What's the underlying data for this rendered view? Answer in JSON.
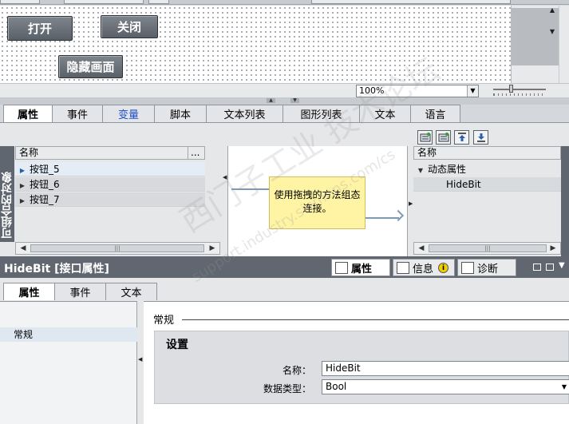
{
  "canvas": {
    "buttons": {
      "open": "打开",
      "close": "关闭",
      "hide_screen": "隐藏画面"
    },
    "zoom": "100%"
  },
  "top_tabs": [
    {
      "label": "属性"
    },
    {
      "label": "事件"
    },
    {
      "label": "变量"
    },
    {
      "label": "脚本"
    },
    {
      "label": "文本列表"
    },
    {
      "label": "图形列表"
    },
    {
      "label": "文本"
    },
    {
      "label": "语言"
    }
  ],
  "left_panel": {
    "side_label": "可组合的对象",
    "header": "名称",
    "header_more": "...",
    "rows": [
      "按钮_5",
      "按钮_6",
      "按钮_7"
    ]
  },
  "center_panel": {
    "hint": "使用拖拽的方法组态连接。"
  },
  "right_panel": {
    "header": "名称",
    "tree": [
      {
        "label": "动态属性"
      },
      {
        "label": "HideBit"
      }
    ]
  },
  "properties": {
    "title": "HideBit [接口属性]",
    "inspector_tabs": [
      {
        "label": "属性"
      },
      {
        "label": "信息"
      },
      {
        "label": "诊断"
      }
    ],
    "info_badge": "i",
    "sub_tabs": [
      {
        "label": "属性"
      },
      {
        "label": "事件"
      },
      {
        "label": "文本"
      }
    ],
    "nav_item": "常规",
    "section": "常规",
    "settings_title": "设置",
    "fields": [
      {
        "label": "名称：",
        "value": "HideBit"
      },
      {
        "label": "数据类型：",
        "value": "Bool"
      }
    ]
  },
  "watermark": {
    "line1": "西门子工业 技术论坛",
    "line2": "support.industry.siemens.com/cs"
  },
  "colors": {
    "accent_blue": "#1f4fc9",
    "hint_yellow": "#fff4a4",
    "title_bar": "#606770"
  }
}
